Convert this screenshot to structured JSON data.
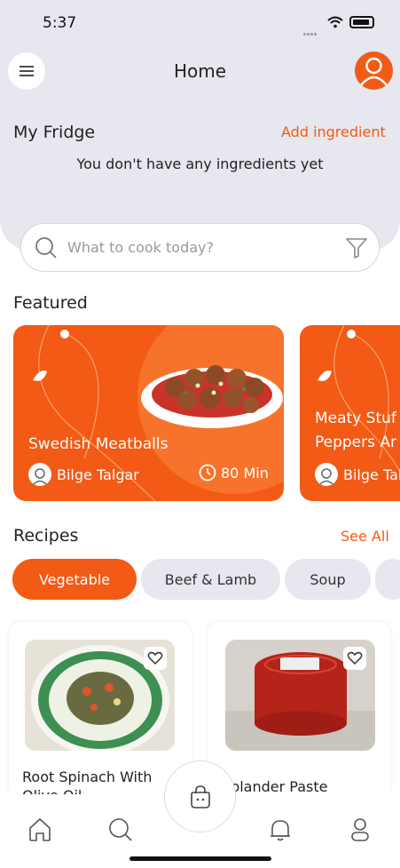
{
  "status_bar": {
    "time": "5:37"
  },
  "header": {
    "title": "Home"
  },
  "fridge": {
    "title": "My Fridge",
    "add_label": "Add ingredient",
    "empty_message": "You don't have any ingredients yet"
  },
  "search": {
    "placeholder": "What to cook today?"
  },
  "featured": {
    "title": "Featured",
    "cards": [
      {
        "title": "Swedish Meatballs",
        "author": "Bilge Talgar",
        "duration": "80 Min"
      },
      {
        "title_line1": "Meaty Stuf",
        "title_line2": "Peppers Ar",
        "author": "Bilge Tal"
      }
    ]
  },
  "recipes": {
    "title": "Recipes",
    "see_all": "See All",
    "categories": [
      "Vegetable",
      "Beef & Lamb",
      "Soup"
    ],
    "selected_category": "Vegetable",
    "items": [
      {
        "name_line1": "Root Spinach With",
        "name_line2": "Olive Oil"
      },
      {
        "name_line1": "iolander Paste"
      }
    ]
  },
  "colors": {
    "accent": "#f25a15",
    "background_top": "#e6e7ef",
    "chip_inactive": "#e6e7ef"
  },
  "icons": [
    "menu-icon",
    "profile-icon",
    "search-icon",
    "filter-icon",
    "clock-icon",
    "heart-icon",
    "home-icon",
    "search-nav-icon",
    "basket-icon",
    "bell-icon",
    "user-icon"
  ]
}
